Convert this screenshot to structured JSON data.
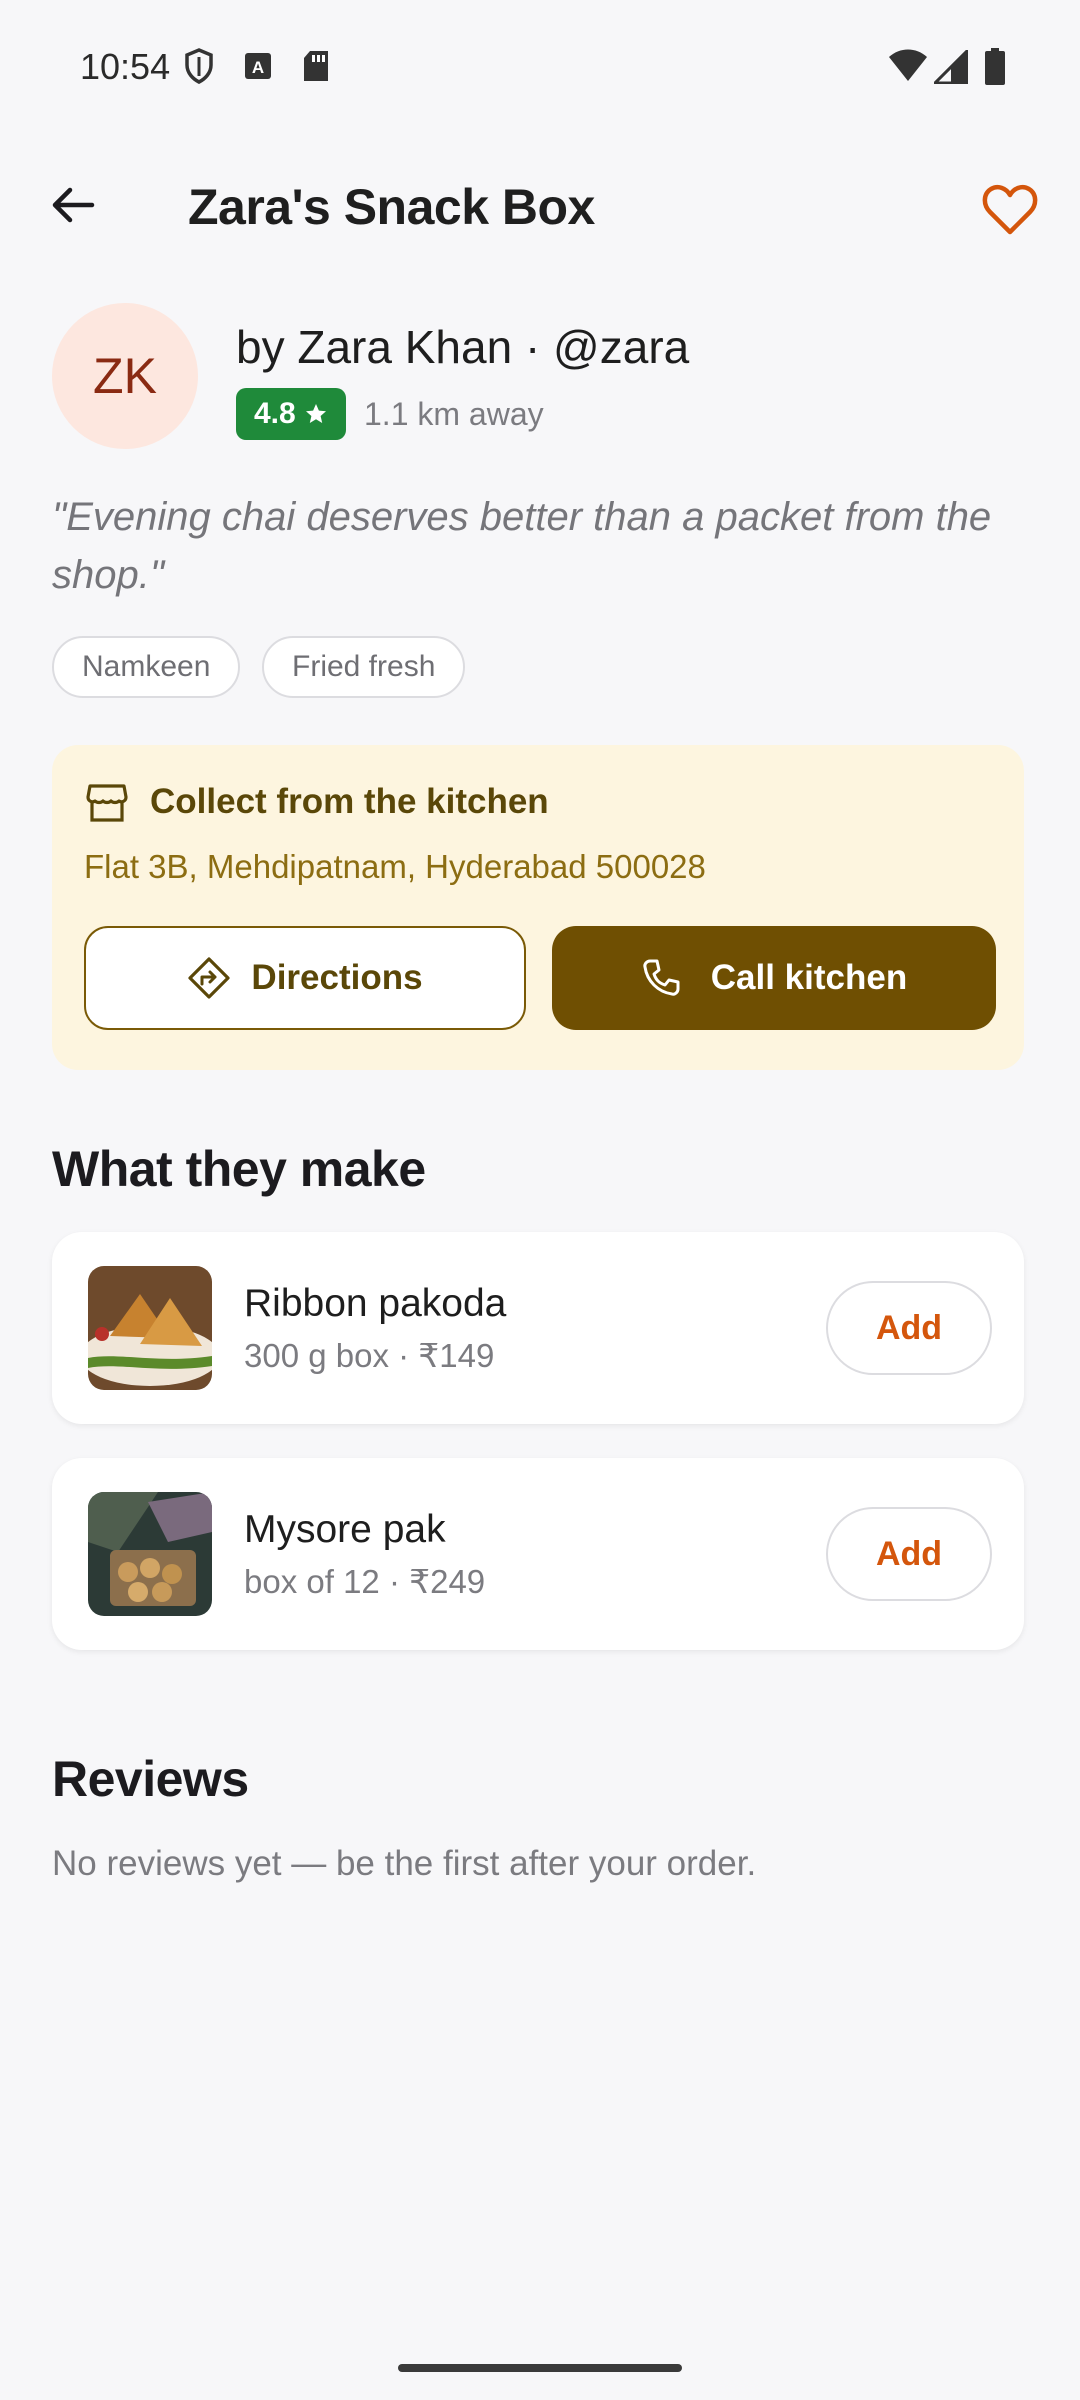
{
  "status_bar": {
    "time": "10:54"
  },
  "app_bar": {
    "title": "Zara's Snack Box"
  },
  "profile": {
    "initials": "ZK",
    "byline": "by Zara Khan · @zara",
    "rating": "4.8",
    "distance": "1.1 km away",
    "quote": "\"Evening chai deserves better than a packet from the shop.\"",
    "tags": [
      "Namkeen",
      "Fried fresh"
    ]
  },
  "pickup": {
    "title": "Collect from the kitchen",
    "address": "Flat 3B, Mehdipatnam, Hyderabad 500028",
    "directions_label": "Directions",
    "call_label": "Call kitchen"
  },
  "menu": {
    "heading": "What they make",
    "add_label": "Add",
    "items": [
      {
        "name": "Ribbon pakoda",
        "meta": "300 g box · ₹149"
      },
      {
        "name": "Mysore pak",
        "meta": "box of 12 · ₹249"
      }
    ]
  },
  "reviews": {
    "heading": "Reviews",
    "empty_text": "No reviews yet — be the first after your order."
  },
  "colors": {
    "accent": "#d4560c",
    "rating_green": "#1f8a3a",
    "pickup_bg": "#fdf5df",
    "call_button": "#6f4f02"
  },
  "icons": [
    "shield-icon",
    "keyboard-icon",
    "sd-card-icon",
    "wifi-icon",
    "signal-icon",
    "battery-icon",
    "back-arrow-icon",
    "heart-icon",
    "star-icon",
    "store-icon",
    "directions-icon",
    "phone-icon"
  ]
}
